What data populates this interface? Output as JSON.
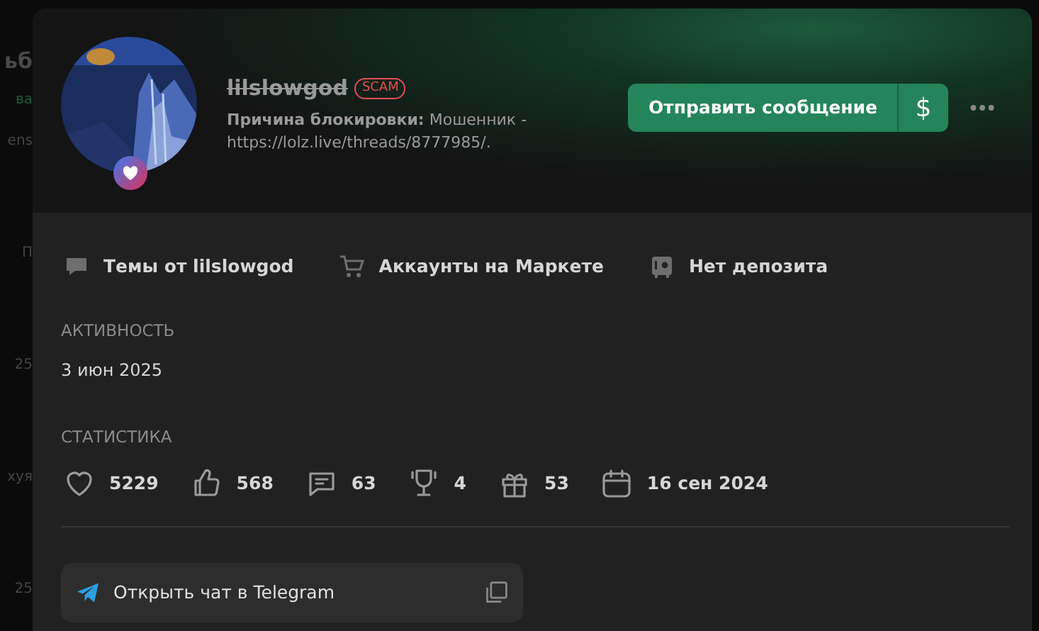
{
  "background_page": {
    "fragments": [
      {
        "text": "ьб",
        "kind": "title"
      },
      {
        "text": "ва",
        "kind": "green"
      },
      {
        "text": "ens",
        "kind": "plain"
      },
      {
        "text": "П",
        "kind": "plain"
      },
      {
        "text": "25",
        "kind": "plain"
      },
      {
        "text": "хуя",
        "kind": "plain"
      },
      {
        "text": "25",
        "kind": "plain"
      }
    ]
  },
  "profile": {
    "username": "lilslowgod",
    "banned": true,
    "badge": "SCAM",
    "ban_reason_label": "Причина блокировки:",
    "ban_reason": "Мошенник - https://lolz.live/threads/8777985/."
  },
  "actions": {
    "message_button": "Отправить сообщение",
    "money_button": "$"
  },
  "links": [
    {
      "label": "Темы от lilslowgod",
      "kind": "chat"
    },
    {
      "label": "Аккаунты на Маркете",
      "kind": "cart"
    },
    {
      "label": "Нет депозита",
      "kind": "safe"
    }
  ],
  "activity": {
    "title": "АКТИВНОСТЬ",
    "value": "3 июн 2025"
  },
  "stats": {
    "title": "СТАТИСТИКА",
    "items": [
      {
        "kind": "heart",
        "value": "5229"
      },
      {
        "kind": "like",
        "value": "568"
      },
      {
        "kind": "message",
        "value": "63"
      },
      {
        "kind": "trophy",
        "value": "4"
      },
      {
        "kind": "gift",
        "value": "53"
      },
      {
        "kind": "calendar",
        "value": "16 сен 2024"
      }
    ]
  },
  "telegram": {
    "label": "Открыть чат в Telegram"
  }
}
